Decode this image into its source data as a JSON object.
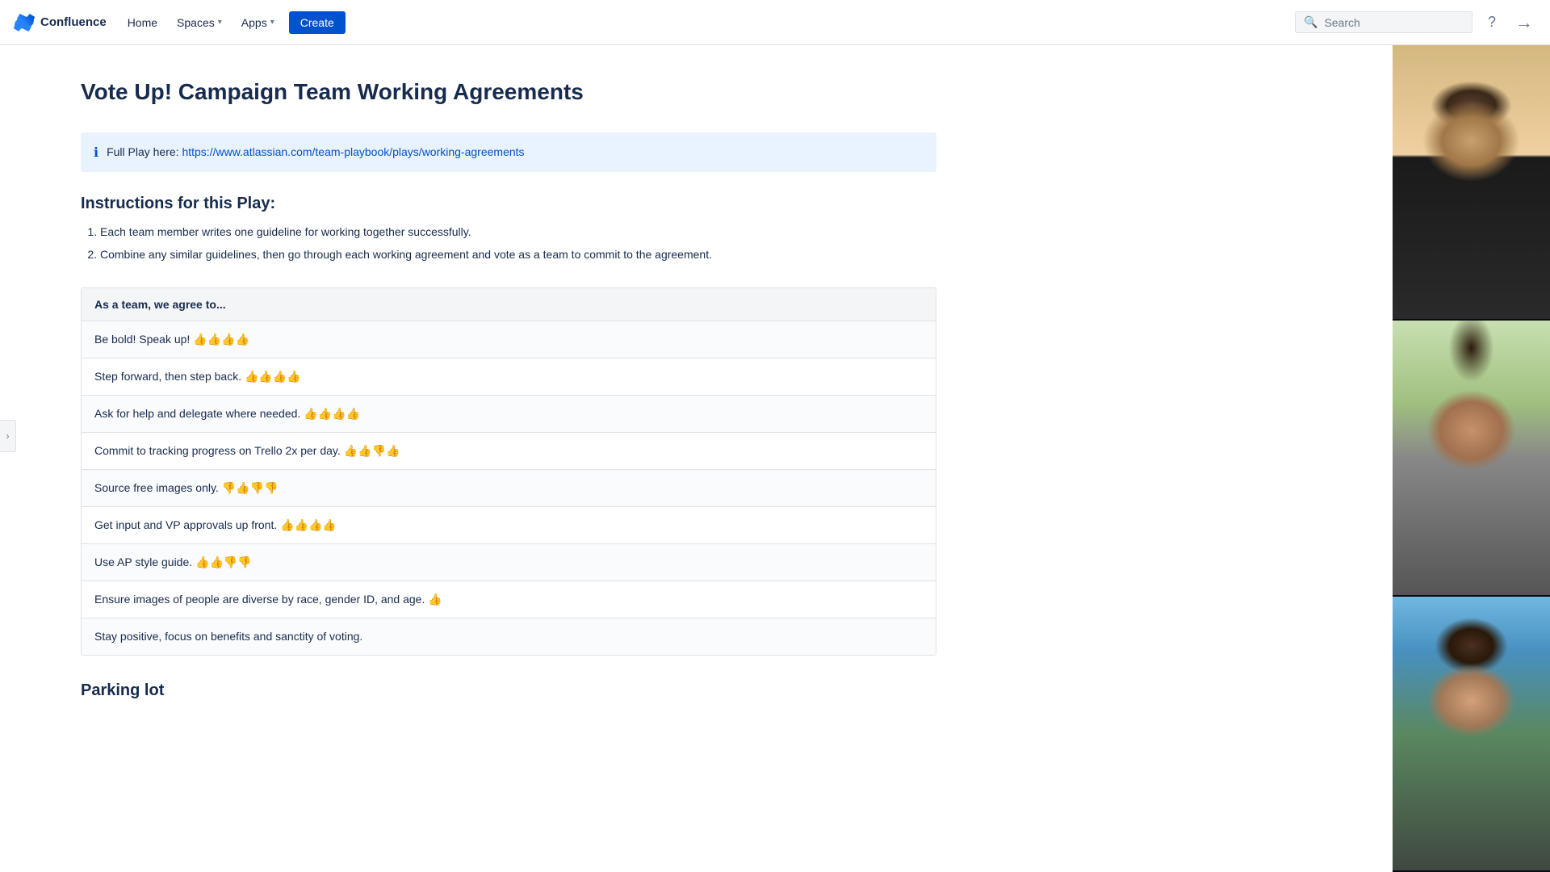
{
  "nav": {
    "logo_text": "Confluence",
    "home_label": "Home",
    "spaces_label": "Spaces",
    "apps_label": "Apps",
    "create_label": "Create",
    "search_placeholder": "Search"
  },
  "page": {
    "title": "Vote Up! Campaign Team Working Agreements",
    "info_prefix": "Full Play here: ",
    "info_link_text": "https://www.atlassian.com/team-playbook/plays/working-agreements",
    "info_link_suffix": "",
    "instructions_heading": "Instructions for this Play:",
    "instructions": [
      "Each team member writes one guideline for working together successfully.",
      "Combine any similar guidelines, then go through each working agreement and vote as a team to commit to the agreement."
    ],
    "table_header": "As a team, we agree to...",
    "agreements": [
      "Be bold! Speak up! 👍👍👍👍",
      "Step forward, then step back. 👍👍👍👍",
      "Ask for help and delegate where needed. 👍👍👍👍",
      "Commit to tracking progress on Trello 2x per day. 👍👍👎👍",
      "Source free images only. 👎👍👎👎",
      "Get input and VP approvals up front. 👍👍👍👍",
      "Use AP style guide. 👍👍👎👎",
      "Ensure images of people are diverse by race, gender ID, and age. 👍",
      "Stay positive, focus on benefits and sanctity of voting."
    ],
    "parking_lot_heading": "Parking lot"
  }
}
